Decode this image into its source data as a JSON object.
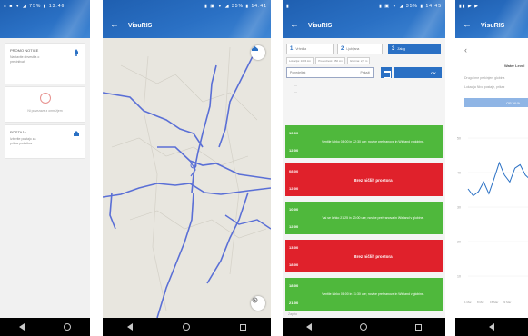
{
  "screens": [
    {
      "id": "settings",
      "status": {
        "time": "≡ ■ ▼ ◢ 75% ▮ 13:46"
      },
      "cards": [
        {
          "title": "PROMO NOTICE",
          "lines": [
            "Nastavite obvestila o",
            "prekinitvah"
          ]
        },
        {
          "warning": "Ni povezave z omrežjem"
        },
        {
          "title": "POSTAJA",
          "lines": [
            "Izberite postajo za",
            "prikaz podatkov"
          ]
        }
      ]
    },
    {
      "id": "map",
      "status": {
        "time": "▮ ▣ ▼ ◢ 35% ▮ 14:41"
      },
      "title": "VisuRIS"
    },
    {
      "id": "slots",
      "status": {
        "time": "▮ ▣ ▼ ◢ 35% ▮ 14:45"
      },
      "title": "VisuRIS",
      "segments": [
        {
          "num": "1",
          "label": "Vrhnika"
        },
        {
          "num": "2",
          "label": "Ljubljana"
        },
        {
          "num": "3",
          "label": "Zalog",
          "active": true
        }
      ],
      "subfilters": [
        "Lokacija: 1024 km",
        "Prevodnost: 450 cm",
        "Globina: 2,5 m"
      ],
      "date": {
        "value": "Ponedeljek",
        "suffix": "Prikaži"
      },
      "ok": "OK",
      "prelines": [
        "—",
        "—"
      ],
      "slots": [
        {
          "color": "green",
          "start": "10:00",
          "end": "12:00",
          "msg": "Ventile lahko 08:00 in 22:30 ure; novice prehranova in Wieland v globine."
        },
        {
          "color": "red",
          "start": "08:00",
          "end": "12:00",
          "msg": "Brez ničlih prostora"
        },
        {
          "color": "green",
          "start": "10:00",
          "end": "12:00",
          "msg": "Vsi se lahko 21:25 in 23:00 ure; novice prehranova in Wieland v globine."
        },
        {
          "color": "red",
          "start": "13:00",
          "end": "18:00",
          "msg": "Brez ničlih prostora"
        },
        {
          "color": "green",
          "start": "18:00",
          "end": "21:00",
          "msg": "Ventile lahko 08:00 in 11:30 ure; novice prehranova in Wieland v globine."
        }
      ],
      "footer": "Zaprto"
    },
    {
      "id": "chart",
      "status": {
        "time": "▮▮ ▶ ▶"
      },
      "title": "VisuRIS",
      "subtitle": "Water Level",
      "lines": [
        "Drugo ime prekinjeni globina",
        "Lokacija Nivo postaje, prikaz"
      ],
      "bar": "OBJAVA",
      "chart_data": {
        "type": "line",
        "x": [
          0,
          1,
          2,
          3,
          4,
          5,
          6,
          7,
          8,
          9,
          10,
          11,
          12,
          13,
          14,
          15
        ],
        "values": [
          150,
          140,
          146,
          160,
          143,
          165,
          188,
          170,
          160,
          180,
          185,
          170,
          163,
          175,
          190,
          180
        ],
        "ylim": [
          0,
          250
        ],
        "ticks": [
          "50",
          "40",
          "30",
          "20",
          "10"
        ],
        "xticks": [
          "1 Mar",
          "8 Mar",
          "15 Mar",
          "22 Mar"
        ]
      }
    }
  ],
  "colors": {
    "primary": "#2a70c4",
    "green": "#4fb83c",
    "red": "#e0212b",
    "road": "#5a6fd6",
    "map": "#e8e6df"
  },
  "icons": [
    "bell-icon",
    "warning-icon",
    "pin-icon",
    "back-arrow-icon",
    "layers-icon",
    "locate-icon",
    "calendar-icon"
  ]
}
